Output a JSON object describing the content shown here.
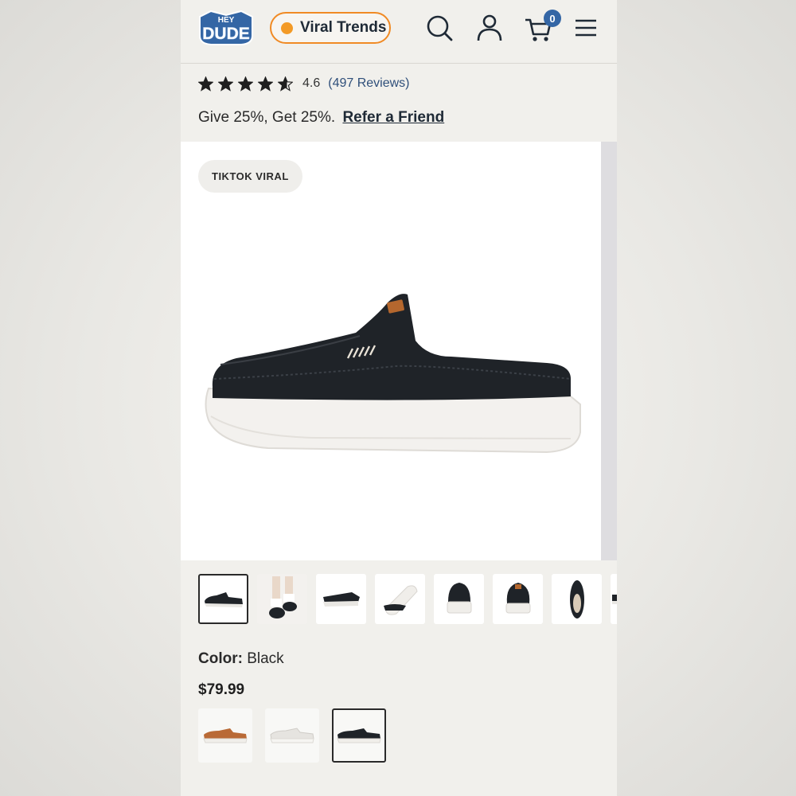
{
  "header": {
    "logo_top": "HEY",
    "logo_main": "DUDE",
    "promo_pill": "Viral Trends",
    "cart_count": "0",
    "icons": [
      "search-icon",
      "account-icon",
      "cart-icon",
      "menu-icon"
    ]
  },
  "rating": {
    "stars_value": 4.6,
    "value_text": "4.6",
    "reviews_text": "(497 Reviews)"
  },
  "referral": {
    "text": "Give 25%, Get 25%.",
    "link": "Refer a Friend"
  },
  "gallery": {
    "badge": "TIKTOK VIRAL",
    "thumbnail_count_visible": 8,
    "active_thumbnail_index": 0
  },
  "product": {
    "color_label": "Color:",
    "color_value": "Black",
    "price": "$79.99",
    "swatches": [
      "Tan",
      "White",
      "Black"
    ],
    "active_swatch_index": 2
  },
  "colors": {
    "accent_orange": "#f08a24",
    "brand_blue": "#3466a5",
    "text_dark": "#1f2a36"
  }
}
